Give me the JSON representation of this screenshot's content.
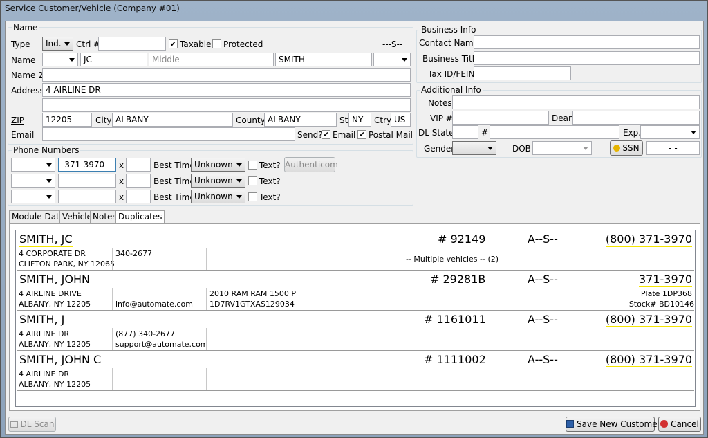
{
  "window": {
    "title": "Service Customer/Vehicle (Company #01)"
  },
  "name_group": {
    "title": "Name",
    "type_label": "Type",
    "type_value": "Ind.",
    "ctrl_label": "Ctrl #",
    "ctrl_value": "",
    "taxable_label": "Taxable",
    "taxable_checked": "✔",
    "protected_label": "Protected",
    "status_code": "---S--",
    "name_label": "Name",
    "prefix_value": "",
    "first_value": "JC",
    "middle_placeholder": "Middle",
    "last_value": "SMITH",
    "suffix_value": "",
    "name2_label": "Name 2",
    "name2_value": "",
    "address_label": "Address",
    "address1_value": "4 AIRLINE DR",
    "address2_value": "",
    "zip_label": "ZIP",
    "zip_value": "12205-",
    "city_label": "City",
    "city_value": "ALBANY",
    "county_label": "County",
    "county_value": "ALBANY",
    "st_label": "St",
    "st_value": "NY",
    "ctry_label": "Ctry",
    "ctry_value": "US",
    "email_label": "Email",
    "email_value": "",
    "send_label": "Send?",
    "send_email_label": "Email",
    "send_postal_label": "Postal Mail",
    "check_mark": "✔"
  },
  "phone_group": {
    "title": "Phone Numbers",
    "x_label": "x",
    "best_time_label": "Best Time",
    "text_label": "Text?",
    "authenticom_label": "Authenticom",
    "rows": [
      {
        "number": "-371-3970",
        "best_time": "Unknown"
      },
      {
        "number": "-  -",
        "best_time": "Unknown"
      },
      {
        "number": "-  -",
        "best_time": "Unknown"
      }
    ]
  },
  "business_group": {
    "title": "Business Info",
    "contact_label": "Contact Name",
    "title_label": "Business Title",
    "tax_label": "Tax ID/FEIN"
  },
  "additional_group": {
    "title": "Additional Info",
    "notes_label": "Notes",
    "vip_label": "VIP #",
    "dear_label": "Dear",
    "dl_state_label": "DL State",
    "hash_label": "#",
    "exp_label": "Exp.",
    "gender_label": "Gender",
    "dob_label": "DOB",
    "ssn_button": "SSN",
    "ssn_value": "-  -"
  },
  "tabs": [
    {
      "label": "Module Data"
    },
    {
      "label": "Vehicle"
    },
    {
      "label": "Notes"
    },
    {
      "label": "Duplicates"
    }
  ],
  "duplicates": [
    {
      "name": "SMITH, JC",
      "number": "# 92149",
      "status": "A--S--",
      "phone": "(800) 371-3970",
      "addr1": "4 CORPORATE DR",
      "addr2": "CLIFTON PARK, NY 12065",
      "contact1": "340-2677",
      "contact2": "",
      "vehicle1": "",
      "vehicle2": "",
      "center": "-- Multiple vehicles -- (2)",
      "right1": "",
      "right2": ""
    },
    {
      "name": "SMITH, JOHN",
      "number": "# 29281B",
      "status": "A--S--",
      "phone": "371-3970",
      "addr1": "4 AIRLINE DRIVE",
      "addr2": "ALBANY, NY 12205",
      "contact1": "",
      "contact2": "info@automate.com",
      "vehicle1": "2010 RAM RAM 1500 P",
      "vehicle2": "1D7RV1GTXAS129034",
      "center": "",
      "right1": "Plate 1DP368",
      "right2": "Stock# BD10146"
    },
    {
      "name": "SMITH, J",
      "number": "# 1161011",
      "status": "A--S--",
      "phone": "(800) 371-3970",
      "addr1": "4 AIRLINE DR",
      "addr2": "ALBANY, NY 12205",
      "contact1": "(877) 340-2677",
      "contact2": "support@automate.com",
      "vehicle1": "",
      "vehicle2": "",
      "center": "",
      "right1": "",
      "right2": ""
    },
    {
      "name": "SMITH, JOHN C",
      "number": "# 1111002",
      "status": "A--S--",
      "phone": "(800) 371-3970",
      "addr1": "4 AIRLINE DR",
      "addr2": "ALBANY, NY 12205",
      "contact1": "",
      "contact2": "",
      "vehicle1": "",
      "vehicle2": "",
      "center": "",
      "right1": "",
      "right2": ""
    }
  ],
  "footer": {
    "dl_scan": "DL Scan",
    "save": "Save New Customer",
    "cancel": "Cancel"
  }
}
